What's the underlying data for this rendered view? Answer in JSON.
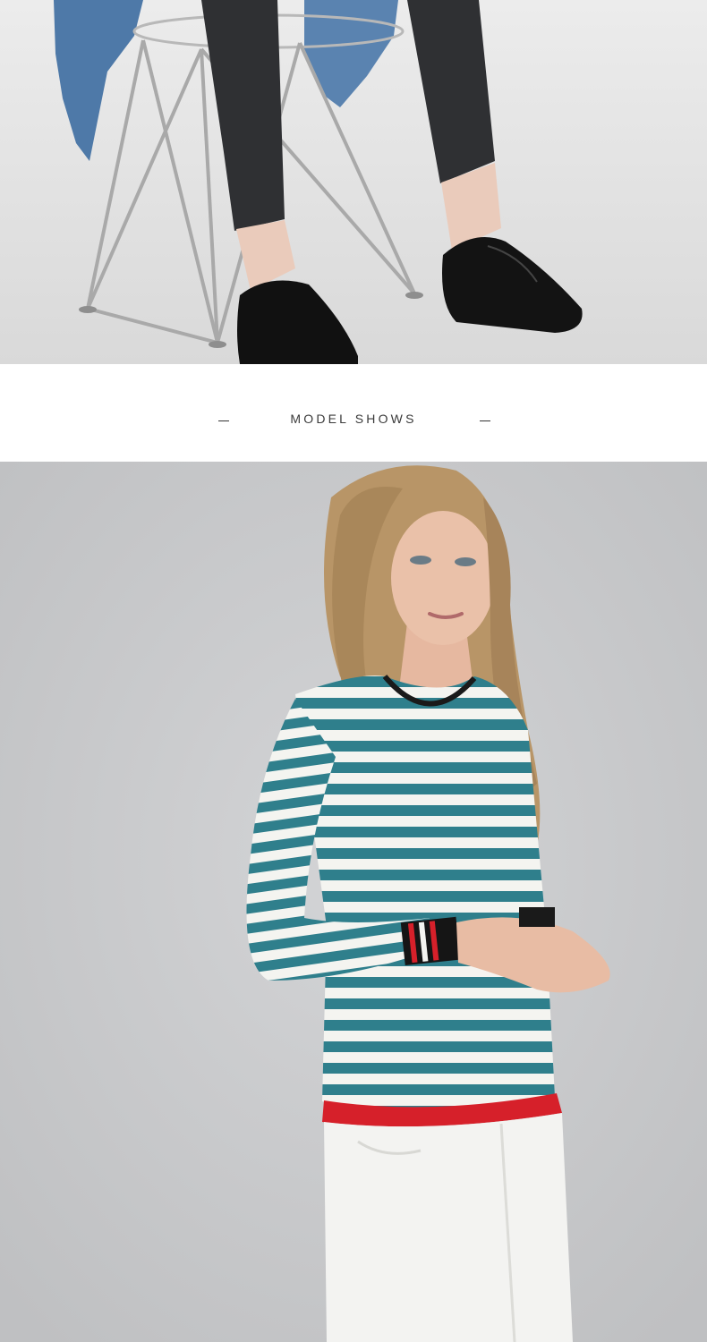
{
  "section_heading": {
    "left_mark": "—",
    "title": "MODEL SHOWS",
    "right_mark": "—"
  },
  "photos": {
    "top": {
      "subject": "legs-and-shoes",
      "colors": {
        "bg": "#e3e3e3",
        "jeans": "#2f3033",
        "shoes": "#111111",
        "denim": "#4e79a8"
      }
    },
    "bottom": {
      "subject": "model-striped-sweater",
      "colors": {
        "bg": "#c8c9cb",
        "stripe_teal": "#2f7f8c",
        "stripe_white": "#f4f4f0",
        "hem_red": "#d6202a",
        "pants": "#f3f3f1",
        "hair": "#b89567",
        "skin": "#eac1a9"
      }
    }
  }
}
